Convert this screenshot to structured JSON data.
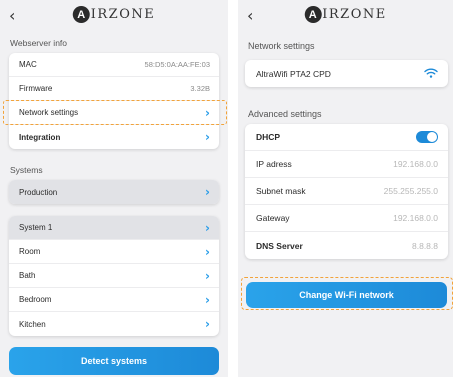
{
  "left": {
    "back_icon": "chevron-left",
    "logo_letter": "A",
    "logo_text": "IRZONE",
    "webserver_info_label": "Webserver info",
    "webserver_rows": [
      {
        "label": "MAC",
        "value": "58:D5:0A:AA:FE:03"
      },
      {
        "label": "Firmware",
        "value": "3.32B"
      }
    ],
    "network_settings_label": "Network settings",
    "integration_label": "Integration",
    "systems_label": "Systems",
    "production_label": "Production",
    "system_label": "System 1",
    "zones": [
      "Room",
      "Bath",
      "Bedroom",
      "Kitchen"
    ],
    "detect_button": "Detect systems"
  },
  "right": {
    "back_icon": "chevron-left",
    "logo_letter": "A",
    "logo_text": "IRZONE",
    "network_settings_label": "Network settings",
    "wifi_name": "AltraWifi PTA2 CPD",
    "wifi_icon": "wifi-icon",
    "advanced_label": "Advanced settings",
    "dhcp_label": "DHCP",
    "dhcp_enabled": true,
    "ip_label": "IP adress",
    "ip_value": "192.168.0.0",
    "subnet_label": "Subnet mask",
    "subnet_value": "255.255.255.0",
    "gateway_label": "Gateway",
    "gateway_value": "192.168.0.0",
    "dns_label": "DNS Server",
    "dns_value": "8.8.8.8",
    "change_wifi_button": "Change Wi-Fi network"
  },
  "colors": {
    "accent": "#1d8ad8",
    "highlight_dash": "#f2a33a",
    "background": "#f1f1f3"
  }
}
